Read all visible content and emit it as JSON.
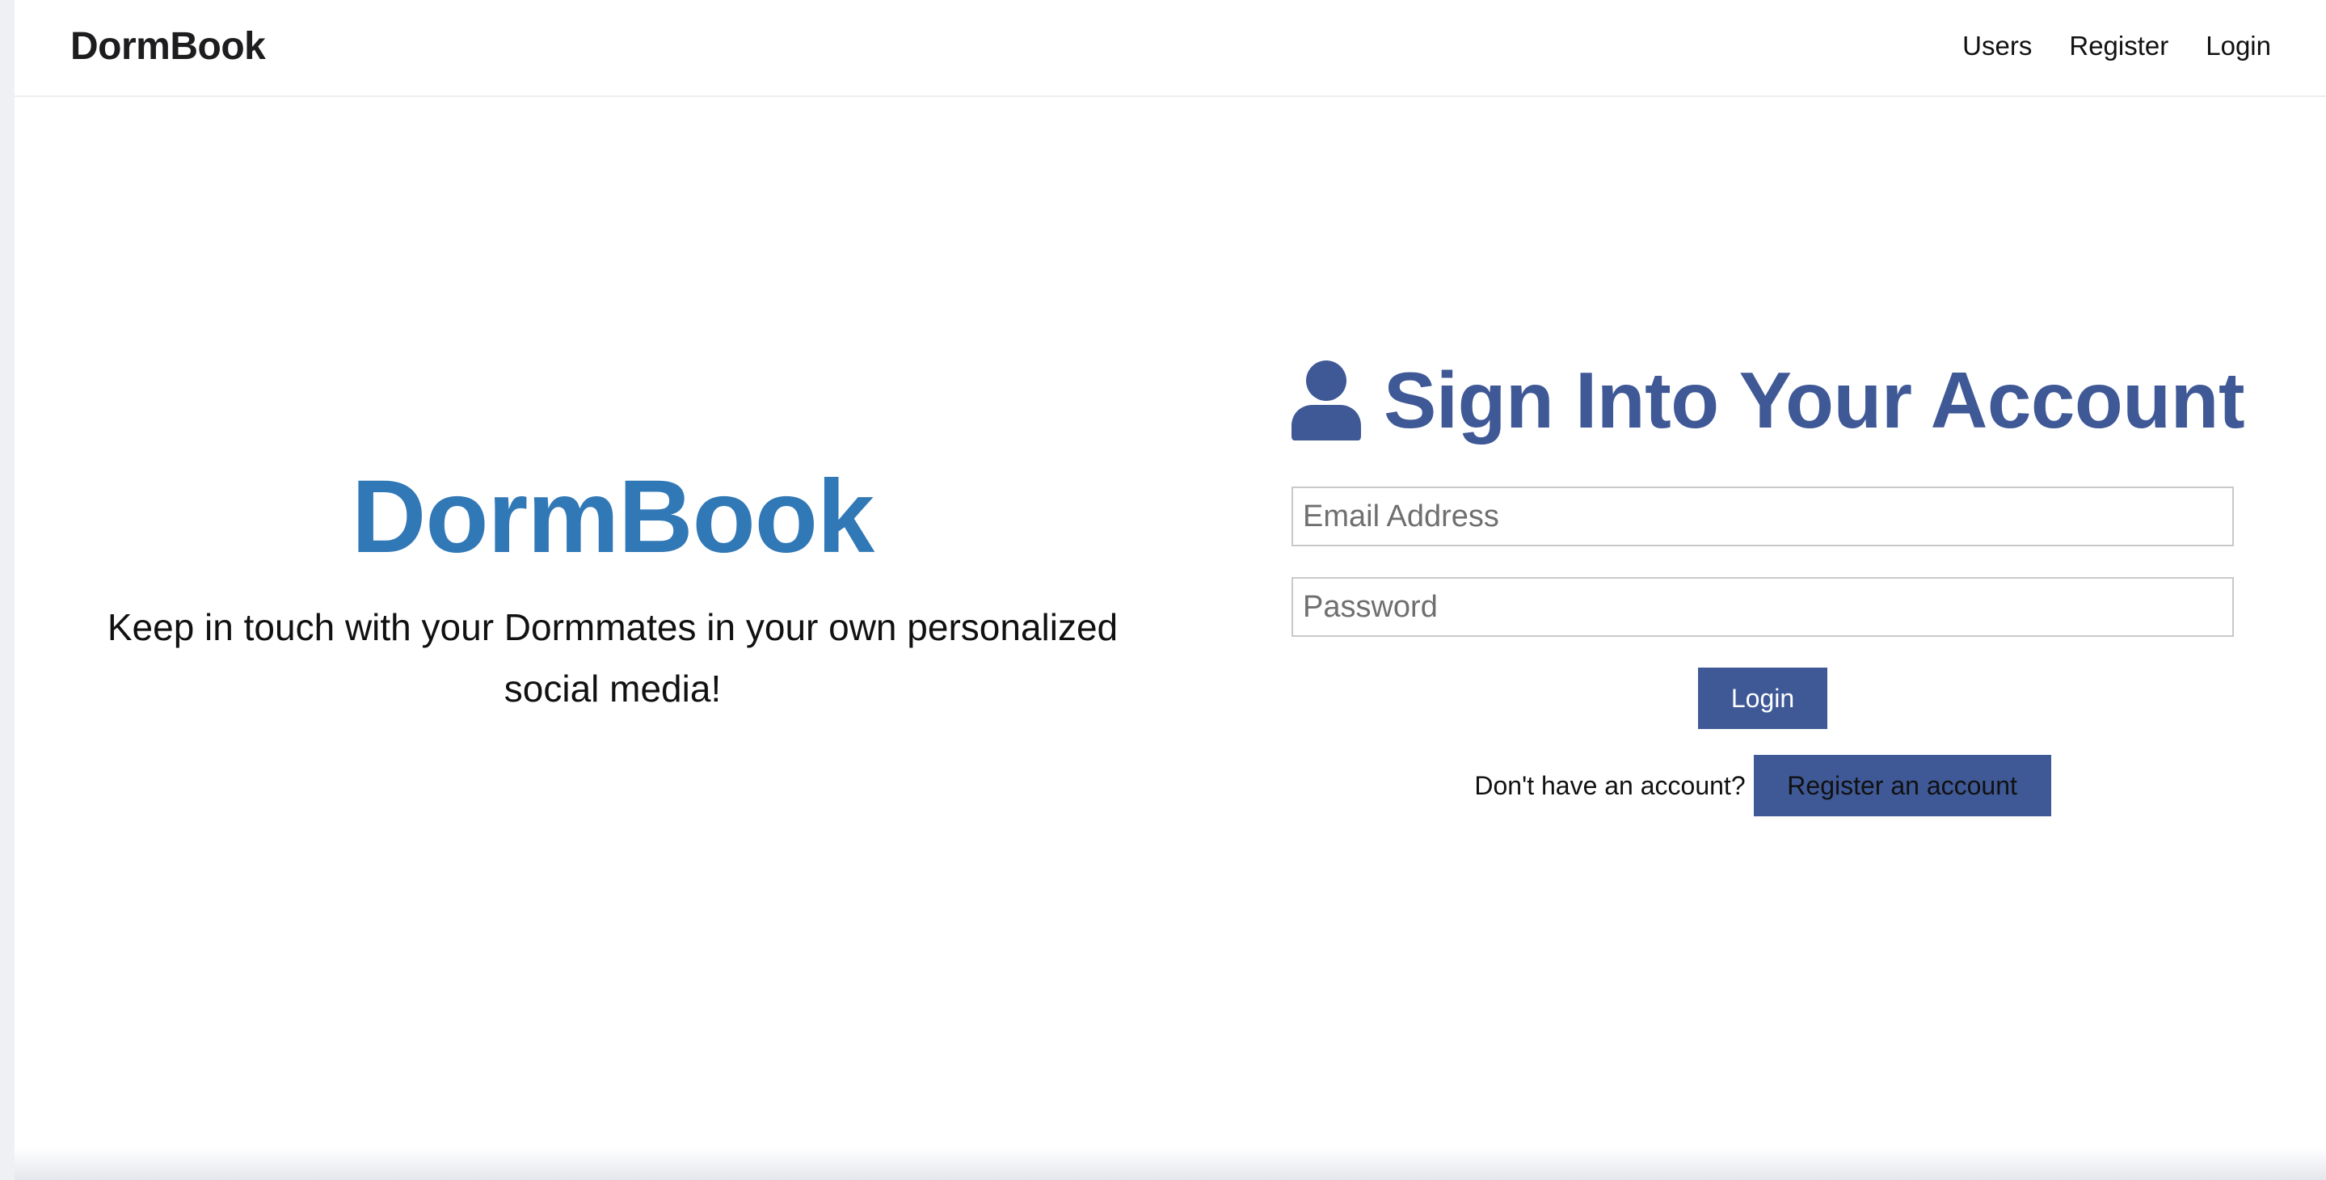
{
  "navbar": {
    "brand": "DormBook",
    "links": [
      {
        "label": "Users"
      },
      {
        "label": "Register"
      },
      {
        "label": "Login"
      }
    ]
  },
  "hero": {
    "title": "DormBook",
    "tagline": "Keep in touch with your Dormmates in your own personalized social media!"
  },
  "login": {
    "icon": "user-icon",
    "title": "Sign Into Your Account",
    "email_placeholder": "Email Address",
    "email_value": "",
    "password_placeholder": "Password",
    "password_value": "",
    "submit_label": "Login",
    "register_prompt": "Don't have an account?",
    "register_label": "Register an account"
  },
  "colors": {
    "brand_blue": "#3178b6",
    "accent_navy": "#3f5896",
    "text": "#111111"
  }
}
